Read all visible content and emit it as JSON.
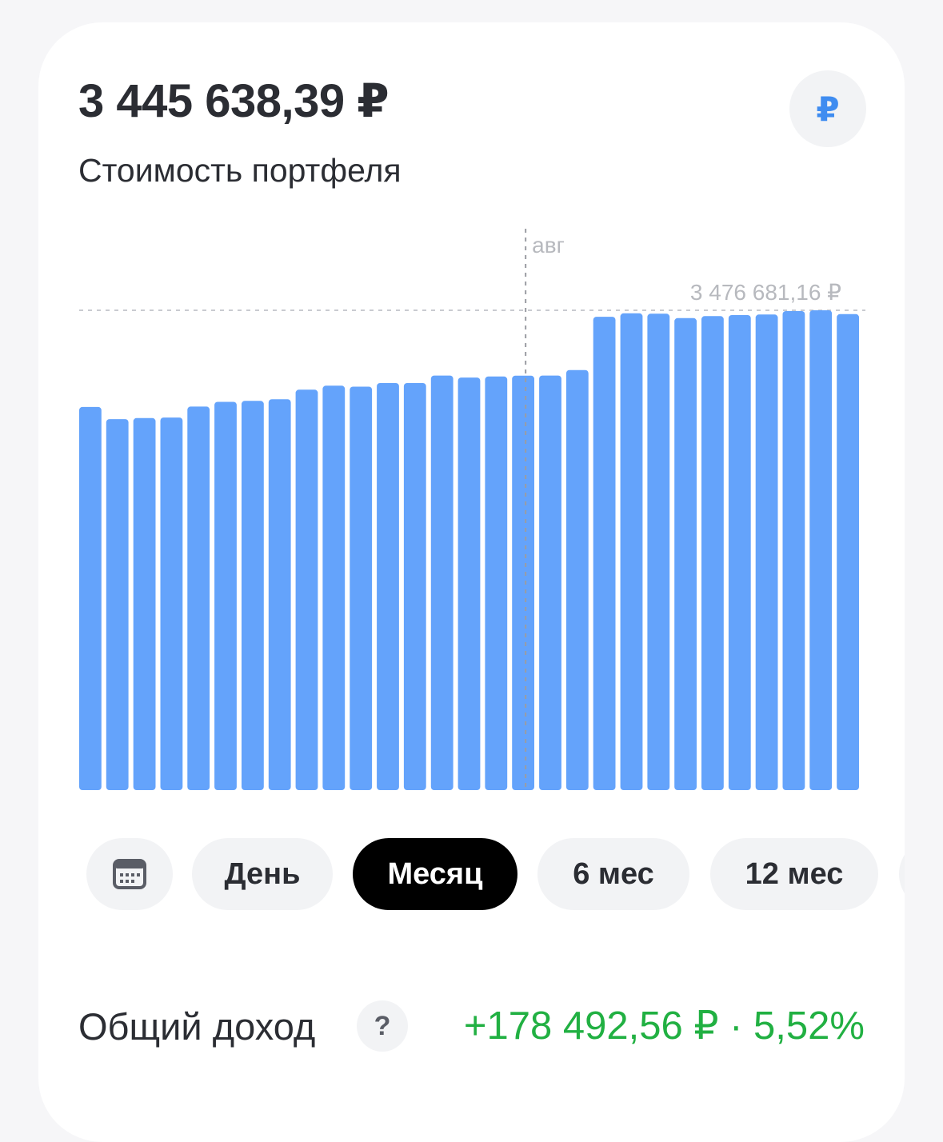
{
  "portfolio": {
    "balance": "3 445 638,39 ₽",
    "subtitle": "Стоимость портфеля",
    "currency_symbol": "₽"
  },
  "periods": {
    "items": [
      {
        "label": "",
        "icon": "calendar-icon"
      },
      {
        "label": "День"
      },
      {
        "label": "Месяц",
        "active": true
      },
      {
        "label": "6 мес"
      },
      {
        "label": "12 мес"
      }
    ]
  },
  "income": {
    "label": "Общий доход",
    "help": "?",
    "value": "+178 492,56 ₽ · 5,52%"
  },
  "chart_data": {
    "type": "bar",
    "series": [
      {
        "values": [
          3429000,
          3423000,
          3423500,
          3423800,
          3429200,
          3431500,
          3432000,
          3432800,
          3437500,
          3439500,
          3439000,
          3440800,
          3440800,
          3444500,
          3443500,
          3444000,
          3444400,
          3444500,
          3447200,
          3473500,
          3475200,
          3475000,
          3472800,
          3473800,
          3474300,
          3474600,
          3476300,
          3476681.16,
          3474800
        ]
      }
    ],
    "ylim": [
      3240000,
      3476681.16
    ],
    "max_label": "3 476 681,16 ₽",
    "x_marker": {
      "label": "авг",
      "index": 16.5
    },
    "colors": {
      "bar": "#64a3fb",
      "guide": "#c9cbd0",
      "label": "#b7b9be",
      "accent": "#3f8cf0",
      "positive": "#21b042"
    },
    "grid": false,
    "legend": "none"
  }
}
